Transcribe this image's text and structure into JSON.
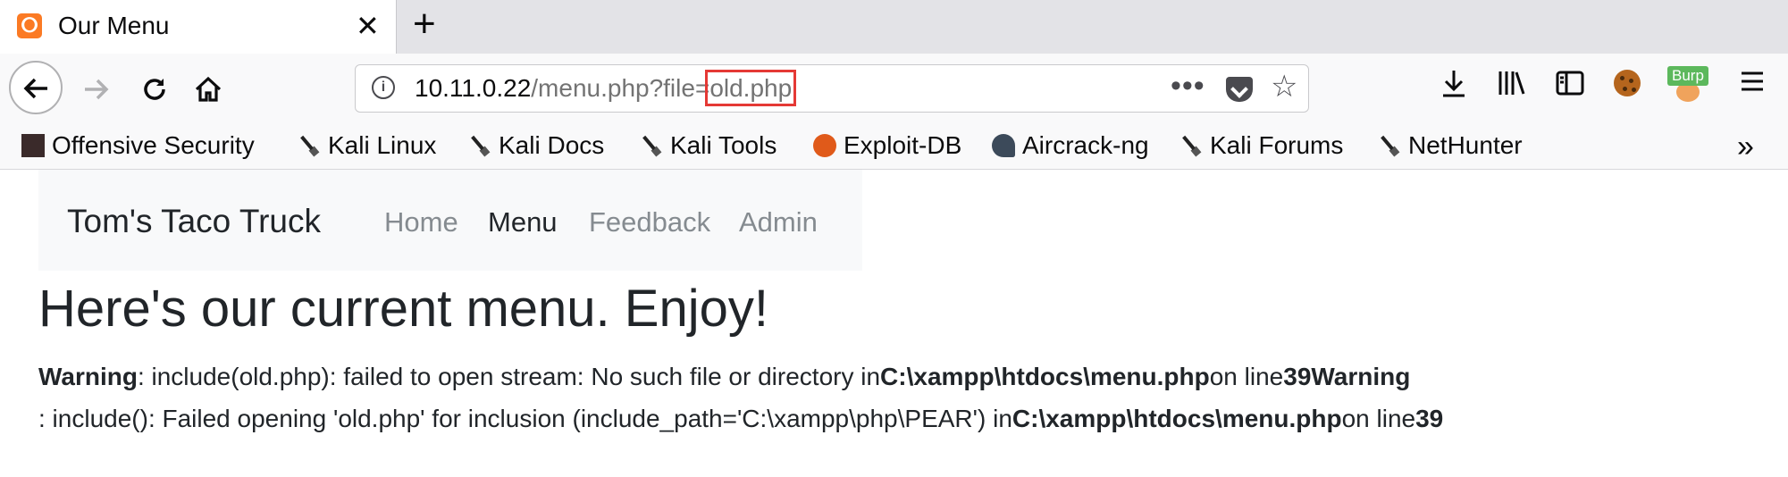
{
  "browser": {
    "tab_title": "Our Menu",
    "tab_close": "✕",
    "new_tab": "+",
    "url_info": "i",
    "url_host": "10.11.0.22",
    "url_path": "/menu.php?file=",
    "url_highlight": "old.php",
    "url_more": "•••",
    "burp_label": "Burp",
    "bookmarks": [
      {
        "label": "Offensive Security"
      },
      {
        "label": "Kali Linux"
      },
      {
        "label": "Kali Docs"
      },
      {
        "label": "Kali Tools"
      },
      {
        "label": "Exploit-DB"
      },
      {
        "label": "Aircrack-ng"
      },
      {
        "label": "Kali Forums"
      },
      {
        "label": "NetHunter"
      }
    ],
    "bookmarks_overflow": "»"
  },
  "site": {
    "brand": "Tom's Taco Truck",
    "nav": [
      {
        "label": "Home"
      },
      {
        "label": "Menu"
      },
      {
        "label": "Feedback"
      },
      {
        "label": "Admin"
      }
    ]
  },
  "main": {
    "heading": "Here's our current menu. Enjoy!",
    "line1_warning_label": "Warning",
    "line1_text": ": include(old.php): failed to open stream: No such file or directory in",
    "line1_path": "C:\\xampp\\htdocs\\menu.php",
    "line1_on_line": "on line",
    "line1_number": "39",
    "line1_warning2": "Warning",
    "line2_text": ": include(): Failed opening 'old.php' for inclusion (include_path='C:\\xampp\\php\\PEAR') in",
    "line2_path": "C:\\xampp\\htdocs\\menu.php",
    "line2_on_line": "on line",
    "line2_number": "39"
  }
}
